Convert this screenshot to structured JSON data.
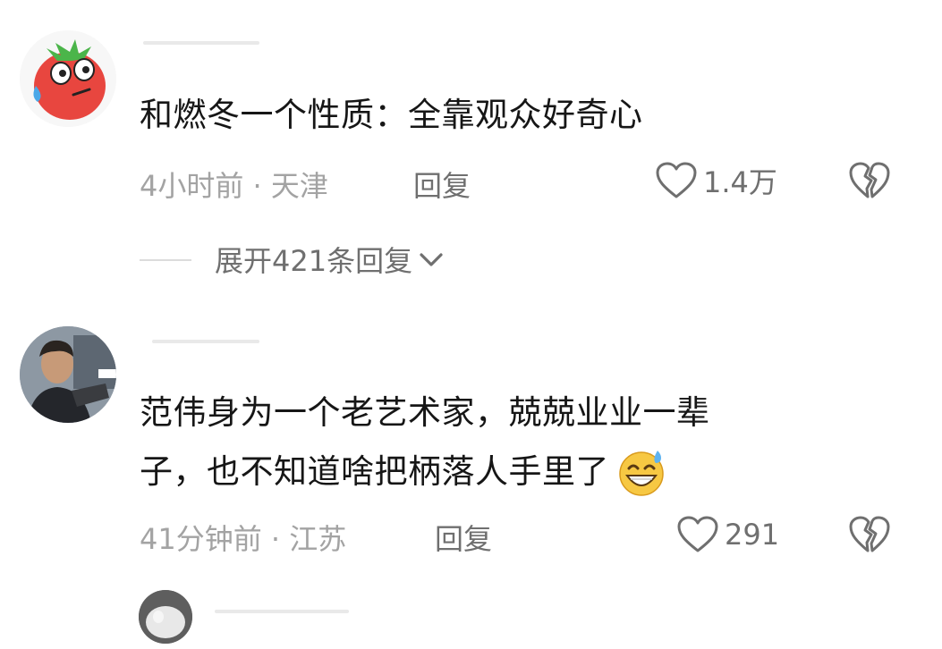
{
  "comments": [
    {
      "text": "和燃冬一个性质：全靠观众好奇心",
      "time_location": "4小时前 · 天津",
      "reply_label": "回复",
      "like_count": "1.4万",
      "expand_label": "展开421条回复"
    },
    {
      "text_line1": "范伟身为一个老艺术家，兢兢业业一辈",
      "text_line2": "子，也不知道啥把柄落人手里了",
      "emoji": "sweat-smile-emoji",
      "time_location": "41分钟前 · 江苏",
      "reply_label": "回复",
      "like_count": "291"
    }
  ],
  "colors": {
    "text": "#161616",
    "meta": "#a3a3a3",
    "secondary": "#6f6f6f"
  },
  "icons": [
    "heart-outline-icon",
    "broken-heart-icon",
    "chevron-down-icon"
  ]
}
